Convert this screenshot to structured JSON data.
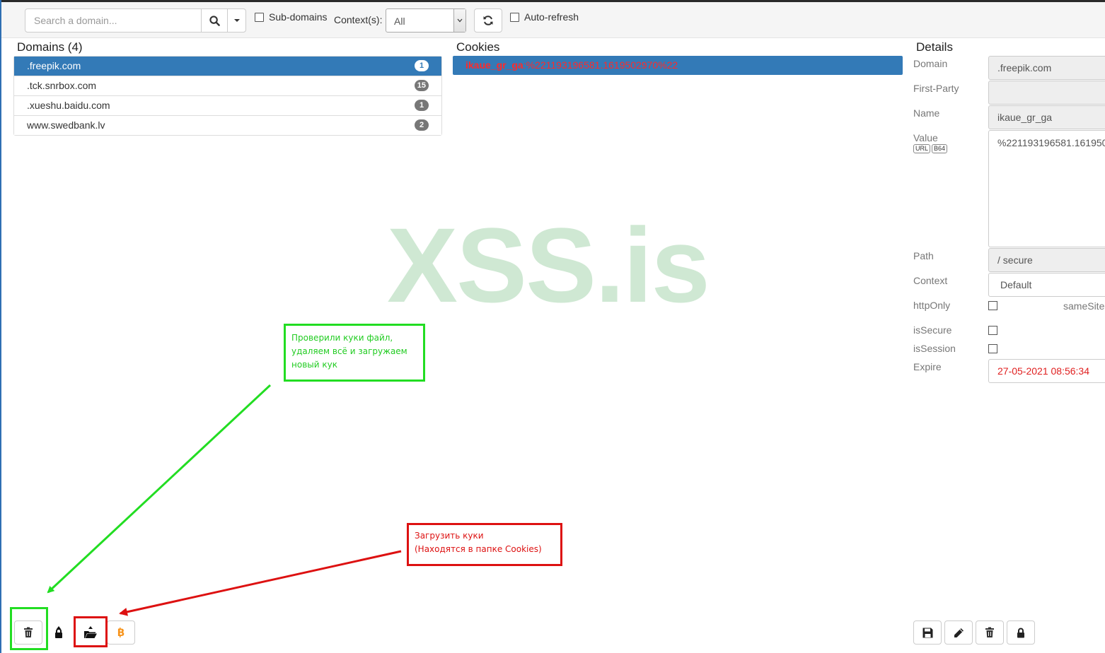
{
  "toolbar": {
    "search_placeholder": "Search a domain...",
    "subdomains_label": "Sub-domains",
    "contexts_label": "Context(s):",
    "contexts_value": "All",
    "autorefresh_label": "Auto-refresh"
  },
  "domains": {
    "title": "Domains (4)",
    "items": [
      {
        "name": ".freepik.com",
        "count": "1"
      },
      {
        "name": ".tck.snrbox.com",
        "count": "15"
      },
      {
        "name": ".xueshu.baidu.com",
        "count": "1"
      },
      {
        "name": "www.swedbank.lv",
        "count": "2"
      }
    ]
  },
  "cookies": {
    "title": "Cookies",
    "items": [
      {
        "name": "ikaue_gr_ga",
        "value": ":%221193196581.1619502970%22"
      }
    ]
  },
  "details": {
    "title": "Details",
    "domain_label": "Domain",
    "domain_value": ".freepik.com",
    "firstparty_label": "First-Party",
    "firstparty_value": "",
    "name_label": "Name",
    "name_value": "ikaue_gr_ga",
    "value_label": "Value",
    "url_tag": "URL",
    "b64_tag": "B64",
    "value_value": "%221193196581.161950",
    "path_label": "Path",
    "path_value": "/ secure",
    "context_label": "Context",
    "context_value": "Default",
    "httponly_label": "httpOnly",
    "samesite_label": "sameSite",
    "issecure_label": "isSecure",
    "issession_label": "isSession",
    "expire_label": "Expire",
    "expire_value": "27-05-2021 08:56:34"
  },
  "watermark": "XSS.is",
  "notes": {
    "green_text": "Проверили куки файл, удаляем всё и загружаем новый кук",
    "red_line1": "Загрузить куки",
    "red_line2": "(Находятся в папке Cookies)"
  },
  "colors": {
    "accent": "#337ab7",
    "note_green": "#22dd22",
    "note_red": "#dd1111",
    "cookie_text": "#ff2a2a",
    "expire_text": "#e02020",
    "bitcoin": "#f7931a"
  },
  "icons": {
    "search": "search-icon",
    "refresh": "refresh-icon",
    "trash": "trash-icon",
    "lock": "lock-icon",
    "folder_open": "folder-open-icon",
    "bitcoin": "bitcoin-icon",
    "save": "save-icon",
    "pencil": "pencil-icon"
  }
}
